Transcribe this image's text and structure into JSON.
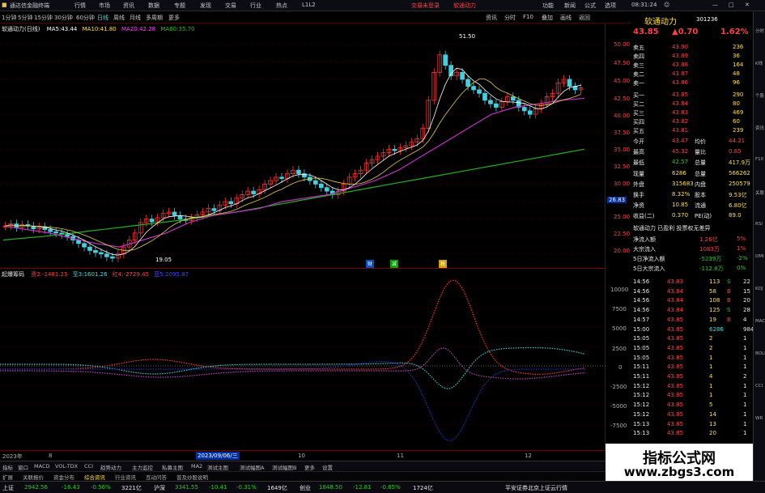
{
  "titlebar": {
    "app": "通达信金融终端",
    "menus": [
      "行情",
      "市场",
      "资讯",
      "数据",
      "专题",
      "发现",
      "交易",
      "行业",
      "热点",
      "L1L2"
    ],
    "login": "交易未登录",
    "stock_name": "软通动力",
    "right_menus": [
      "功能",
      "新闻",
      "公式",
      "选项"
    ],
    "clock": "08:31:24"
  },
  "toolbar": {
    "periods": [
      "1分钟",
      "5分钟",
      "15分钟",
      "30分钟",
      "60分钟",
      "日线",
      "周线",
      "月线",
      "多周期",
      "更多"
    ],
    "right_items": [
      "资讯",
      "分时",
      "F10",
      "叠加",
      "画线",
      "返回"
    ]
  },
  "chart": {
    "stock_label": "软通动力(日线)",
    "ma": [
      {
        "label": "MA5:",
        "value": "43.44",
        "color": "#ffffff"
      },
      {
        "label": "MA10:",
        "value": "41.80",
        "color": "#ffe040"
      },
      {
        "label": "MA20:",
        "value": "42.28",
        "color": "#ff40ff"
      },
      {
        "label": "MA60:",
        "value": "35.70",
        "color": "#20c020"
      }
    ],
    "high_marker": "51.50",
    "low_marker": "19.05",
    "price_axis": [
      "50.00",
      "47.50",
      "45.00",
      "42.50",
      "40.00",
      "37.50",
      "35.00",
      "32.50",
      "30.00",
      "27.50",
      "25.00",
      "22.50",
      "20.00"
    ],
    "current_price_tag": "26.83",
    "events": [
      "财",
      "减",
      "税"
    ]
  },
  "chart_data": {
    "type": "line",
    "series": [
      {
        "name": "MA60",
        "values": [
          22,
          22.3,
          22.6,
          23,
          23.4,
          23.8,
          24.2,
          24.6,
          25,
          25.5,
          26,
          26.6,
          27.2,
          27.8,
          28.4,
          29,
          29.6,
          30.2,
          30.8,
          31.4,
          32,
          32.6,
          33.2,
          33.8,
          34.4,
          35
        ]
      },
      {
        "name": "MA20",
        "values": [
          24,
          23.5,
          23,
          22.2,
          21.5,
          21,
          22,
          23,
          24.5,
          25.5,
          26,
          26.5,
          27.5,
          28,
          28.5,
          29.5,
          30.5,
          32,
          34,
          36,
          38,
          40,
          41,
          41.5,
          42,
          42.3
        ]
      }
    ]
  },
  "indicator": {
    "name": "起爆筹码",
    "values": [
      {
        "label": "资2:",
        "value": "-1481.25",
        "color": "#ff4040"
      },
      {
        "label": "至3:",
        "value": "1601.26",
        "color": "#40e0e0"
      },
      {
        "label": "红4:",
        "value": "-2729.45",
        "color": "#ff4040"
      },
      {
        "label": "蓝5:",
        "value": "2095.87",
        "color": "#4040ff"
      }
    ],
    "axis": [
      "10000",
      "7500",
      "5000",
      "2500",
      "0",
      "-2500",
      "-5000",
      "-7500"
    ]
  },
  "datebar": {
    "year_label": "2023年",
    "cursor_date": "2023/09/06/三",
    "months": [
      "8",
      "10",
      "11",
      "12"
    ]
  },
  "tabs": [
    "指标",
    "窗口",
    "MACD",
    "VOL-TDX",
    "CCI",
    "趋势动力",
    "主力监控",
    "私募主图",
    "MA2",
    "测试主图",
    "测试幅图A",
    "测试幅图B",
    "更多",
    "设置"
  ],
  "tabs2": [
    "扩展",
    "关联报价",
    "资金分布",
    "综合资讯",
    "行业资讯",
    "互动问答",
    "普及炒股说明"
  ],
  "status": {
    "sh_label": "上证",
    "sh_price": "2942.56",
    "sh_chg": "-16.43",
    "sh_pct": "-0.56%",
    "sh_vol": "3221亿",
    "sz_label": "沪深",
    "sz_price": "3341.55",
    "sz_chg": "-10.41",
    "sz_pct": "-0.31%",
    "sz_vol": "1649亿",
    "cy_label": "创业",
    "cy_price": "1848.50",
    "cy_chg": "-12.81",
    "cy_pct": "-0.65%",
    "cy_vol": "1724亿",
    "server": "平安证券北京上证云行情"
  },
  "panel": {
    "name": "软通动力",
    "code": "301236",
    "price": "43.85",
    "change": "▲0.70",
    "pct": "1.62%",
    "asks": [
      {
        "label": "卖五",
        "price": "43.90",
        "vol": "236"
      },
      {
        "label": "卖四",
        "price": "43.89",
        "vol": "36"
      },
      {
        "label": "卖三",
        "price": "43.88",
        "vol": "164"
      },
      {
        "label": "卖二",
        "price": "43.87",
        "vol": "48"
      },
      {
        "label": "卖一",
        "price": "43.86",
        "vol": "96"
      }
    ],
    "bids": [
      {
        "label": "买一",
        "price": "43.85",
        "vol": "290"
      },
      {
        "label": "买二",
        "price": "43.84",
        "vol": "80"
      },
      {
        "label": "买三",
        "price": "43.83",
        "vol": "469"
      },
      {
        "label": "买四",
        "price": "43.82",
        "vol": "60"
      },
      {
        "label": "买五",
        "price": "43.81",
        "vol": "239"
      }
    ],
    "stats": [
      {
        "l1": "今开",
        "v1": "43.47",
        "l2": "均价",
        "v2": "44.21"
      },
      {
        "l1": "最高",
        "v1": "45.32",
        "l2": "量比",
        "v2": "0.85"
      },
      {
        "l1": "最低",
        "v1": "42.57",
        "l2": "总量",
        "v2": "417.9万"
      },
      {
        "l1": "现量",
        "v1": "6286",
        "l2": "总量",
        "v2": "566262"
      },
      {
        "l1": "外盘",
        "v1": "315683",
        "l2": "内盘",
        "v2": "250579"
      },
      {
        "l1": "换手",
        "v1": "8.32%",
        "l2": "股本",
        "v2": "9.53亿"
      },
      {
        "l1": "净资",
        "v1": "10.85",
        "l2": "流通",
        "v2": "6.80亿"
      },
      {
        "l1": "收益(二)",
        "v1": "0.370",
        "l2": "PE(动)",
        "v2": "89.0"
      }
    ],
    "tagline": "软通动力 已盈利 投票权无差异",
    "flows": [
      {
        "label": "净流入额",
        "value": "1.26亿",
        "pct": "5%"
      },
      {
        "label": "大宗流入",
        "value": "1083万",
        "pct": "1%"
      },
      {
        "label": "5日净流入额",
        "value": "-5239万",
        "pct": "-2%"
      },
      {
        "label": "5日大宗流入",
        "value": "-112.8万",
        "pct": "0%"
      }
    ],
    "ticks": [
      {
        "t": "14:56",
        "p": "43.83",
        "v": "113",
        "d": "S",
        "n": "22"
      },
      {
        "t": "14:56",
        "p": "43.84",
        "v": "58",
        "d": "B",
        "n": "15"
      },
      {
        "t": "14:56",
        "p": "43.84",
        "v": "108",
        "d": "B",
        "n": "20"
      },
      {
        "t": "14:56",
        "p": "43.84",
        "v": "125",
        "d": "S",
        "n": "28"
      },
      {
        "t": "14:57",
        "p": "43.85",
        "v": "19",
        "d": "B",
        "n": "4"
      },
      {
        "t": "15:00",
        "p": "43.85",
        "v": "6286",
        "d": "",
        "n": "984"
      },
      {
        "t": "15:05",
        "p": "43.85",
        "v": "2",
        "d": "",
        "n": "1"
      },
      {
        "t": "15:05",
        "p": "43.85",
        "v": "2",
        "d": "",
        "n": "1"
      },
      {
        "t": "15:05",
        "p": "43.85",
        "v": "1",
        "d": "",
        "n": "1"
      },
      {
        "t": "15:11",
        "p": "43.85",
        "v": "1",
        "d": "",
        "n": "1"
      },
      {
        "t": "15:11",
        "p": "43.85",
        "v": "4",
        "d": "",
        "n": "2"
      },
      {
        "t": "15:12",
        "p": "43.85",
        "v": "1",
        "d": "",
        "n": "1"
      },
      {
        "t": "15:12",
        "p": "43.85",
        "v": "1",
        "d": "",
        "n": "1"
      },
      {
        "t": "15:12",
        "p": "43.85",
        "v": "5",
        "d": "",
        "n": "1"
      },
      {
        "t": "15:12",
        "p": "43.85",
        "v": "14",
        "d": "",
        "n": "1"
      },
      {
        "t": "15:13",
        "p": "43.85",
        "v": "13",
        "d": "",
        "n": "1"
      },
      {
        "t": "15:13",
        "p": "43.85",
        "v": "20",
        "d": "",
        "n": "1"
      }
    ]
  },
  "watermark": {
    "line1": "指标公式网",
    "line2": "www.zbgs3.com"
  },
  "sidebar": [
    "分时",
    "K线",
    "个股",
    "资讯",
    "F10",
    "关联",
    "RSI",
    "DMI",
    "KDJ",
    "MACD",
    "BOLL",
    "CCI",
    "WR"
  ]
}
